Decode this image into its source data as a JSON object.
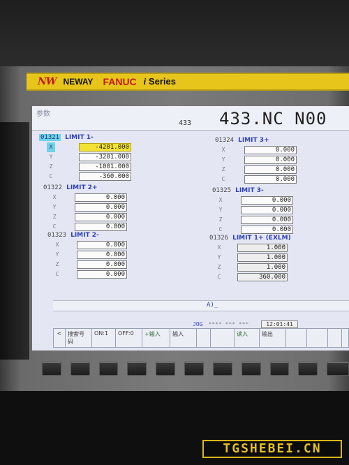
{
  "brand": {
    "logo": "NW",
    "name": "NEWAY",
    "cnc": "FANUC",
    "series_i": "i",
    "series": "Series"
  },
  "header": {
    "screen_title": "参数",
    "prog_no": "433",
    "program": "433.NC N00"
  },
  "params": [
    {
      "id": "01321",
      "label": "LIMIT 1-",
      "values": [
        {
          "axis": "X",
          "value": "-4201.000"
        },
        {
          "axis": "Y",
          "value": "-3201.000"
        },
        {
          "axis": "Z",
          "value": "-1001.000"
        },
        {
          "axis": "C",
          "value": "-360.000"
        }
      ]
    },
    {
      "id": "01322",
      "label": "LIMIT 2+",
      "values": [
        {
          "axis": "X",
          "value": "0.000"
        },
        {
          "axis": "Y",
          "value": "0.000"
        },
        {
          "axis": "Z",
          "value": "0.000"
        },
        {
          "axis": "C",
          "value": "0.000"
        }
      ]
    },
    {
      "id": "01323",
      "label": "LIMIT 2-",
      "values": [
        {
          "axis": "X",
          "value": "0.000"
        },
        {
          "axis": "Y",
          "value": "0.000"
        },
        {
          "axis": "Z",
          "value": "0.000"
        },
        {
          "axis": "C",
          "value": "0.000"
        }
      ]
    },
    {
      "id": "01324",
      "label": "LIMIT 3+",
      "values": [
        {
          "axis": "X",
          "value": "0.000"
        },
        {
          "axis": "Y",
          "value": "0.000"
        },
        {
          "axis": "Z",
          "value": "0.000"
        },
        {
          "axis": "C",
          "value": "0.000"
        }
      ]
    },
    {
      "id": "01325",
      "label": "LIMIT 3-",
      "values": [
        {
          "axis": "X",
          "value": "0.000"
        },
        {
          "axis": "Y",
          "value": "0.000"
        },
        {
          "axis": "Z",
          "value": "0.000"
        },
        {
          "axis": "C",
          "value": "0.000"
        }
      ]
    },
    {
      "id": "01326",
      "label": "LIMIT 1+ (EXLM)",
      "values": [
        {
          "axis": "X",
          "value": "1.000"
        },
        {
          "axis": "Y",
          "value": "1.000"
        },
        {
          "axis": "Z",
          "value": "1.000"
        },
        {
          "axis": "C",
          "value": "360.000"
        }
      ]
    }
  ],
  "cmdline": {
    "prompt": "A)_"
  },
  "status": {
    "mode": "JOG",
    "indicator": "**** *** ***",
    "time": "12:01:41"
  },
  "softkeys": {
    "prev": "<",
    "search": "搜索号码",
    "on1": "ON:1",
    "off0": "OFF:0",
    "plus_input": "+输入",
    "input": "输入",
    "blank1": "",
    "blank2": "",
    "read": "读入",
    "punch": "输出",
    "blank3": "",
    "blank4": "",
    "blank5": "",
    "next": ""
  },
  "watermark": "TGSHEBEI.CN",
  "colors": {
    "screen_bg": "#e4e7f3",
    "label_blue": "#2f3fb8",
    "highlight_yellow": "#f3e233",
    "highlight_cyan": "#6fd2ea",
    "brand_yellow": "#e8c51b"
  }
}
